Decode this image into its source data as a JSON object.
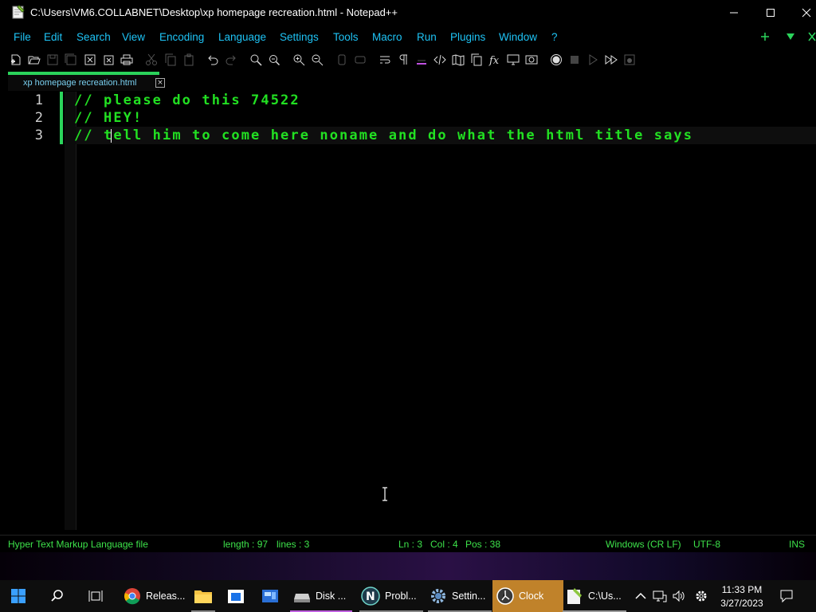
{
  "window": {
    "title": "C:\\Users\\VM6.COLLABNET\\Desktop\\xp homepage recreation.html - Notepad++"
  },
  "menu": {
    "items": [
      {
        "label": "File"
      },
      {
        "label": "Edit"
      },
      {
        "label": "Search"
      },
      {
        "label": "View"
      },
      {
        "label": "Encoding"
      },
      {
        "label": "Language"
      },
      {
        "label": "Settings"
      },
      {
        "label": "Tools"
      },
      {
        "label": "Macro"
      },
      {
        "label": "Run"
      },
      {
        "label": "Plugins"
      },
      {
        "label": "Window"
      },
      {
        "label": "?"
      }
    ]
  },
  "tab": {
    "label": "xp homepage recreation.html",
    "close_glyph": "×"
  },
  "editor": {
    "lines": [
      {
        "num": "1",
        "text": "// please do this 74522"
      },
      {
        "num": "2",
        "text": "// HEY!"
      },
      {
        "num": "3",
        "text": "// tell him to come here noname and do what the html title says"
      }
    ]
  },
  "status": {
    "file_type": "Hyper Text Markup Language file",
    "length": "length : 97",
    "lines": "lines : 3",
    "ln": "Ln : 3",
    "col": "Col : 4",
    "pos": "Pos : 38",
    "eol": "Windows (CR LF)",
    "encoding": "UTF-8",
    "mode": "INS"
  },
  "taskbar": {
    "apps": [
      {
        "label": "Releas..."
      },
      {
        "label": "Disk ..."
      },
      {
        "label": "Probl..."
      },
      {
        "label": "Settin..."
      },
      {
        "label": "Clock"
      },
      {
        "label": "C:\\Us..."
      }
    ],
    "time": "11:33 PM",
    "date": "3/27/2023"
  },
  "colors": {
    "menu_text": "#1ec3f5",
    "code_text": "#22e022",
    "status_text": "#3de24a",
    "tab_accent": "#2bd45b",
    "active_taskbar": "#c0822a"
  }
}
